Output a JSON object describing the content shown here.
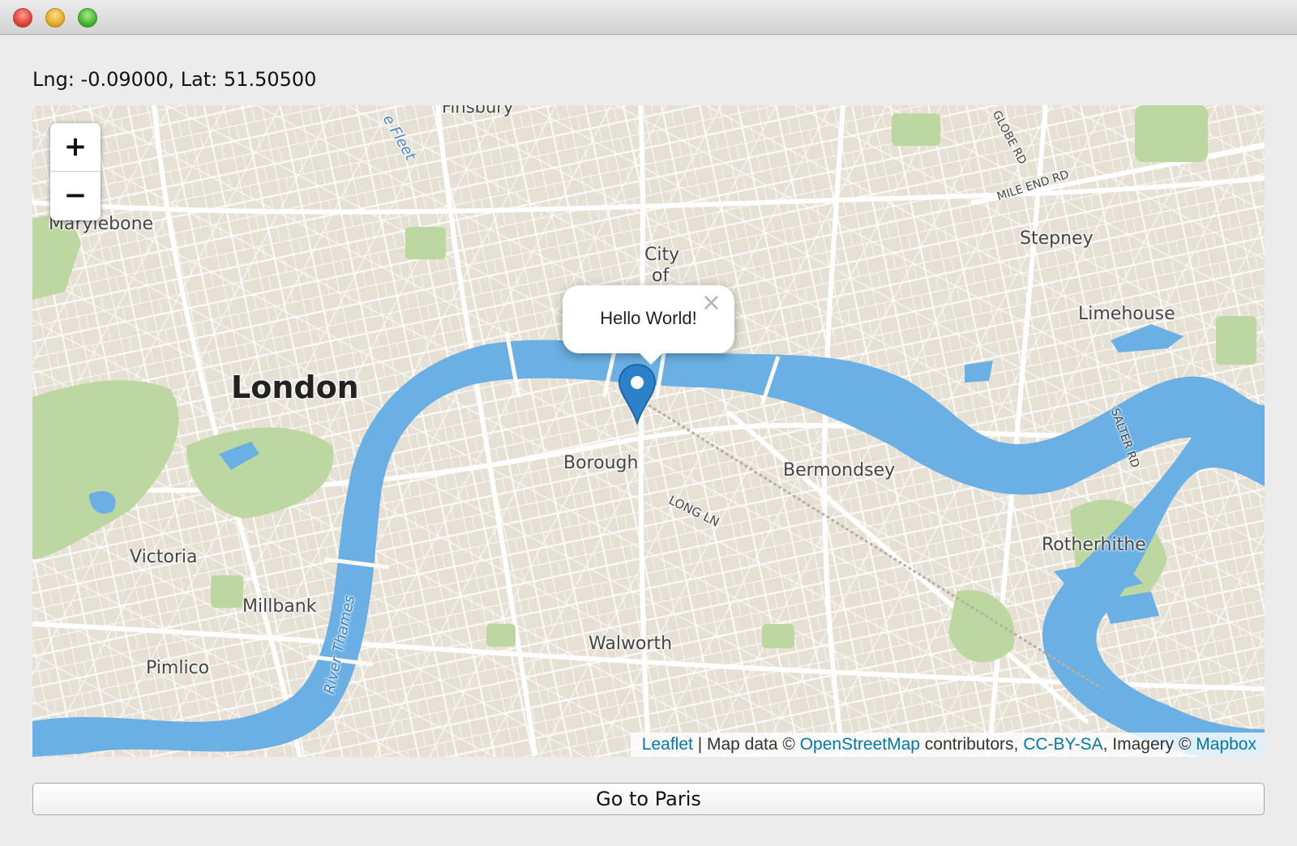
{
  "window": {
    "title": ""
  },
  "coords_label": "Lng: -0.09000, Lat: 51.50500",
  "map": {
    "zoom_in": "+",
    "zoom_out": "−",
    "places": {
      "finsbury": "Finsbury",
      "fleet": "e Fleet",
      "marylebone": "Marylebone",
      "city": "City",
      "city_of": "of",
      "london": "London",
      "stepney": "Stepney",
      "limehouse": "Limehouse",
      "borough": "Borough",
      "bermondsey": "Bermondsey",
      "long_ln": "LONG LN",
      "river_thames": "River Thames",
      "victoria": "Victoria",
      "millbank": "Millbank",
      "pimlico": "Pimlico",
      "walworth": "Walworth",
      "rotherhithe": "Rotherhithe",
      "globe_rd": "GLOBE RD",
      "mile_end_rd": "MILE END RD",
      "salter_rd": "SALTER RD"
    },
    "popup": {
      "text": "Hello World!",
      "close": "×"
    },
    "attribution": {
      "leaflet": "Leaflet",
      "sep": " | Map data © ",
      "osm": "OpenStreetMap",
      "contributors": " contributors, ",
      "license": "CC-BY-SA",
      "imagery": ", Imagery © ",
      "mapbox": "Mapbox"
    },
    "colors": {
      "water": "#6ab0e4",
      "land": "#e8e2d8",
      "park": "#bcd8a0",
      "marker": "#2b82cb"
    }
  },
  "button": {
    "label": "Go to Paris"
  }
}
